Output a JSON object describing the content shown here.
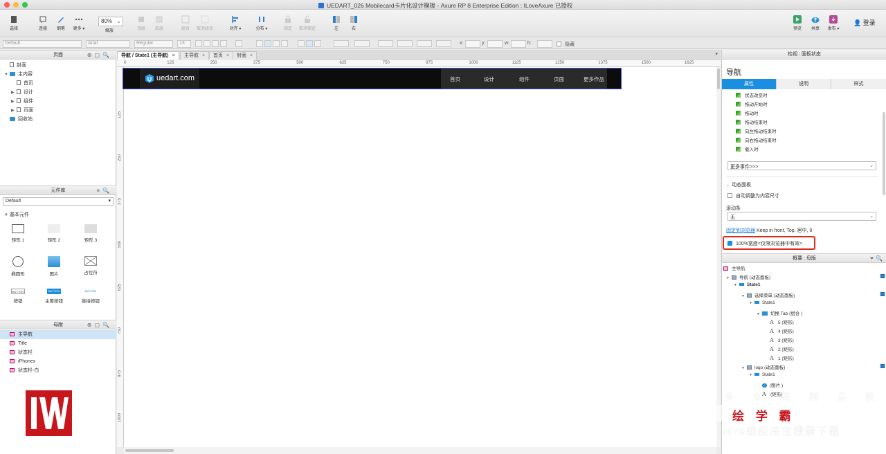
{
  "window": {
    "title": "UEDART_026 Mobilecard卡片化设计模板 - Axure RP 8 Enterprise Edition : ILoveAxure 已授权"
  },
  "toolbar": {
    "select": "选择",
    "connect": "连接",
    "pen": "钢笔",
    "more": "更多 ▾",
    "zoom_value": "80%",
    "zoom_label": "缩放",
    "top": "顶层",
    "bottom": "底层",
    "group": "组合",
    "ungroup": "取消组合",
    "align": "对齐 ▾",
    "distribute": "分布 ▾",
    "lock": "锁定",
    "unlock": "取消锁定",
    "left": "左",
    "right": "右",
    "preview": "预览",
    "share": "共享",
    "publish": "发布 ▾",
    "login": "登录"
  },
  "formatbar": {
    "style": "Default",
    "font": "Arial",
    "weight": "Regular",
    "size": "13",
    "x_label": "x:",
    "y_label": "y:",
    "w_label": "w:",
    "h_label": "h:",
    "hidden_label": "隐藏"
  },
  "pages": {
    "header": "页面",
    "items": [
      {
        "label": "封面",
        "type": "page",
        "level": 0
      },
      {
        "label": "主内容",
        "type": "folder",
        "level": 0
      },
      {
        "label": "首页",
        "type": "page",
        "level": 1
      },
      {
        "label": "设计",
        "type": "page",
        "level": 1
      },
      {
        "label": "组件",
        "type": "page",
        "level": 1
      },
      {
        "label": "页面",
        "type": "page",
        "level": 1
      },
      {
        "label": "回收站",
        "type": "folder",
        "level": 0
      }
    ]
  },
  "library": {
    "header": "元件库",
    "selected": "Default",
    "group": "基本元件",
    "items": [
      "矩形 1",
      "矩形 2",
      "矩形 3",
      "椭圆形",
      "图片",
      "占位符",
      "按钮",
      "主要按钮",
      "链接按钮"
    ],
    "button_text": "BUTTON"
  },
  "masters": {
    "header": "母版",
    "items": [
      "主导航",
      "Title",
      "状态栏",
      "iPhonex",
      "状态栏-白"
    ]
  },
  "tabs": [
    {
      "label": "导航 / State1 (主导航)",
      "active": true
    },
    {
      "label": "主导航",
      "active": false
    },
    {
      "label": "首页",
      "active": false
    },
    {
      "label": "封面",
      "active": false
    }
  ],
  "ruler": {
    "h": [
      "0",
      "125",
      "250",
      "375",
      "500",
      "625",
      "750",
      "875",
      "1000",
      "1125",
      "1250",
      "1375",
      "1500",
      "1625"
    ],
    "v": [
      "125",
      "250",
      "375",
      "500",
      "625",
      "750",
      "875",
      "1000"
    ]
  },
  "canvas": {
    "logo_text": "uedart.com",
    "nav_items": [
      "首页",
      "设计",
      "组件",
      "页面",
      "更多作品"
    ]
  },
  "inspector": {
    "header": "检视 : 面板状态",
    "title": "导航",
    "tabs": [
      "属性",
      "说明",
      "样式"
    ],
    "events": [
      "状态改变时",
      "拖动开始时",
      "拖动时",
      "拖动结束时",
      "向左拖动结束时",
      "向右拖动结束时",
      "载入时"
    ],
    "more_events": "更多事件>>>",
    "section": "动态面板",
    "auto_fit": "自动调整为内容尺寸",
    "scrollbar_label": "滚动条",
    "scrollbar_value": "无",
    "pin_link": "固定到浏览器",
    "pin_text": "Keep in front, Top, 居中, 0",
    "full_width": "100%宽度<仅限浏览器中有效>"
  },
  "outline": {
    "header": "概要 : 母版",
    "root": "主导航",
    "items": [
      {
        "label": "导航 (动态面板)",
        "icon": "dp",
        "level": 0
      },
      {
        "label": "State1",
        "icon": "state",
        "level": 1,
        "bold": true
      },
      {
        "label": "选择菜单 (动态面板)",
        "icon": "dp",
        "level": 2
      },
      {
        "label": "State1",
        "icon": "state",
        "level": 3
      },
      {
        "label": "切换 Tab (组合 )",
        "icon": "group",
        "level": 4
      },
      {
        "label": "5 (矩形)",
        "icon": "text",
        "level": 5
      },
      {
        "label": "4 (矩形)",
        "icon": "text",
        "level": 5
      },
      {
        "label": "3 (矩形)",
        "icon": "text",
        "level": 5
      },
      {
        "label": "2 (矩形)",
        "icon": "text",
        "level": 5
      },
      {
        "label": "1 (矩形)",
        "icon": "text",
        "level": 5
      },
      {
        "label": "logo (动态面板)",
        "icon": "dp",
        "level": 2
      },
      {
        "label": "State1",
        "icon": "state",
        "level": 3
      },
      {
        "label": "(图片 )",
        "icon": "image",
        "level": 4
      },
      {
        "label": "(矩形)",
        "icon": "text",
        "level": 4
      }
    ]
  },
  "watermark": {
    "line1": "多 免 费 精 品 教 程",
    "line2": "绘 学 霸",
    "line3": "tore或应用宝搜索下载"
  }
}
